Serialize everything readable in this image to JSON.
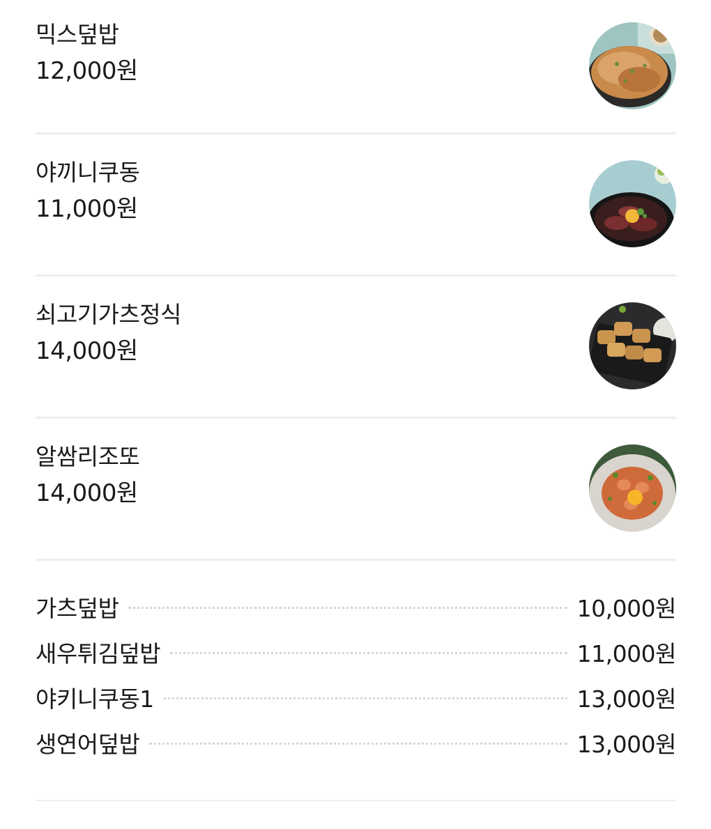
{
  "featured_items": [
    {
      "name": "믹스덮밥",
      "price": "12,000원",
      "image_icon": "mix-rice-bowl-photo"
    },
    {
      "name": "야끼니쿠동",
      "price": "11,000원",
      "image_icon": "yakiniku-don-photo"
    },
    {
      "name": "쇠고기가츠정식",
      "price": "14,000원",
      "image_icon": "beef-katsu-set-photo"
    },
    {
      "name": "알쌈리조또",
      "price": "14,000원",
      "image_icon": "roe-risotto-photo"
    }
  ],
  "simple_items": [
    {
      "name": "가츠덮밥",
      "price": "10,000원"
    },
    {
      "name": "새우튀김덮밥",
      "price": "11,000원"
    },
    {
      "name": "야키니쿠동1",
      "price": "13,000원"
    },
    {
      "name": "생연어덮밥",
      "price": "13,000원"
    }
  ]
}
